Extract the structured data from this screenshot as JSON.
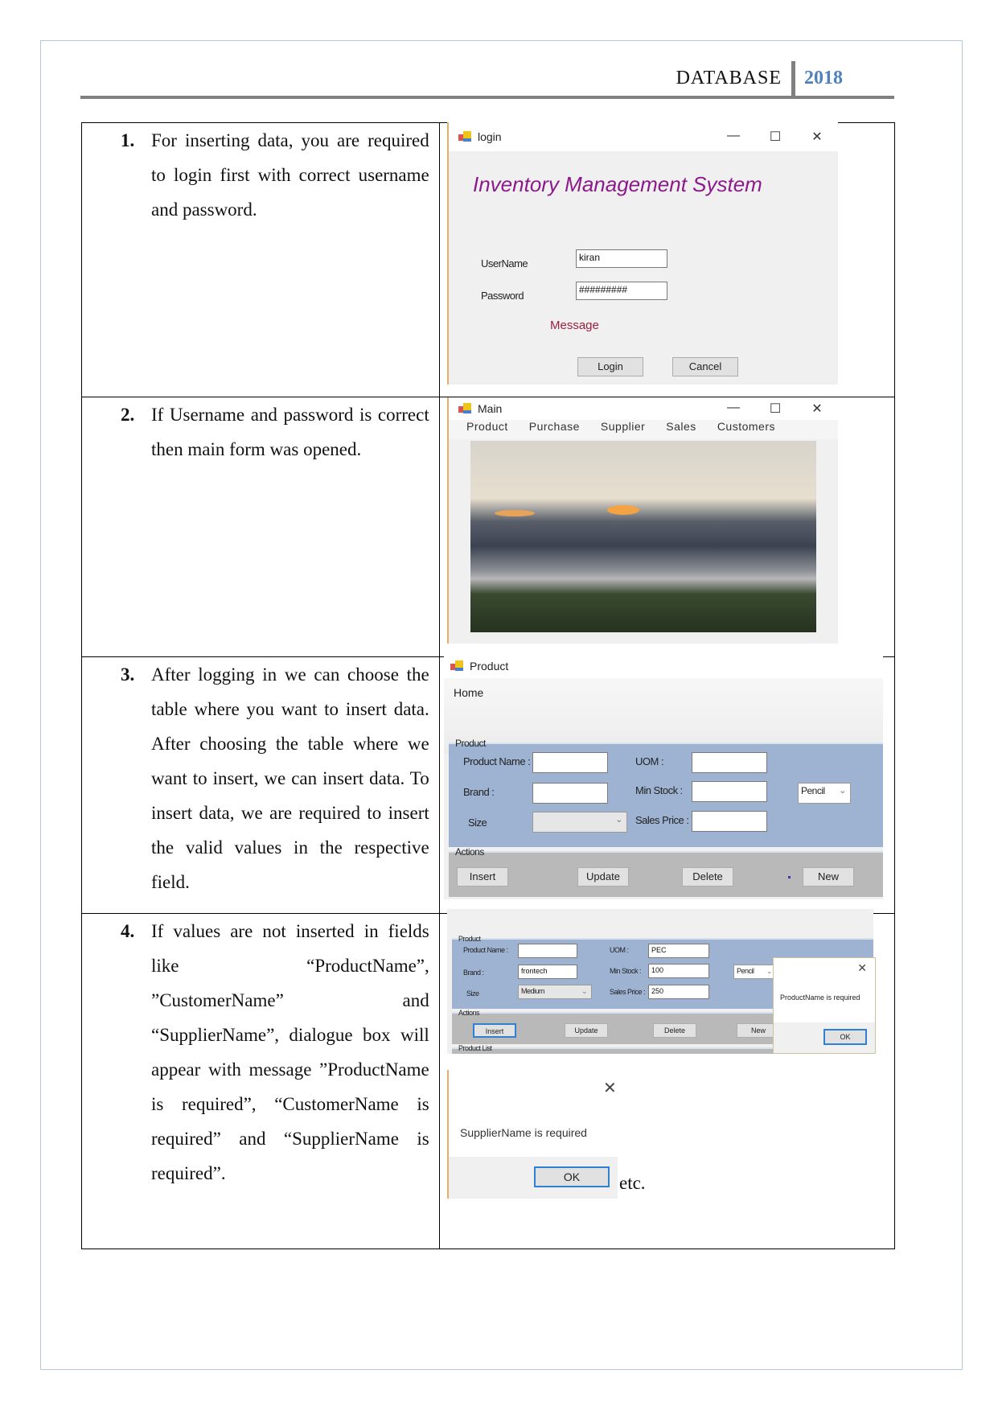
{
  "header": {
    "title": "DATABASE",
    "year": "2018"
  },
  "steps": [
    {
      "num": "1.",
      "text": "For inserting data, you are required to login first with correct username and password."
    },
    {
      "num": "2.",
      "text": "If Username and password is correct then main form was opened."
    },
    {
      "num": "3.",
      "text": "After logging in we can choose the table where you want to insert data. After choosing the table where we want to insert, we can insert data. To insert data, we are required to insert the valid values in the respective field."
    },
    {
      "num": "4.",
      "text": "If values are not inserted in fields like “ProductName”, ”CustomerName” and “SupplierName”, dialogue box will appear with message ”ProductName is required”, “CustomerName is required” and “SupplierName is required”."
    }
  ],
  "window_controls": {
    "minimize": "—",
    "maximize": "☐",
    "close": "✕"
  },
  "login": {
    "title": "login",
    "heading": "Inventory Management System",
    "username_label": "UserName",
    "username_value": "kiran",
    "password_label": "Password",
    "password_value": "#########",
    "message": "Message",
    "login_button": "Login",
    "cancel_button": "Cancel",
    "heading_color": "#8b1a8b"
  },
  "main": {
    "title": "Main",
    "menu": [
      "Product",
      "Purchase",
      "Supplier",
      "Sales",
      "Customers"
    ],
    "image_description": "sunset-clouds-landscape"
  },
  "product_form": {
    "title": "Product",
    "home_tab": "Home",
    "group_product": "Product",
    "group_actions": "Actions",
    "group_list": "Product List",
    "labels": {
      "product_name": "Product Name :",
      "brand": "Brand :",
      "size": "Size",
      "uom": "UOM :",
      "min_stock": "Min Stock :",
      "sales_price": "Sales Price :"
    },
    "empty_values": {
      "product_name": "",
      "brand": "",
      "size": "",
      "uom": "",
      "min_stock": "",
      "sales_price": "",
      "category": "Pencil"
    },
    "filled_values": {
      "product_name": "",
      "brand": "frontech",
      "size": "Medium",
      "uom": "PEC",
      "min_stock": "100",
      "sales_price": "250",
      "category": "Pencil"
    },
    "buttons": {
      "insert": "Insert",
      "update": "Update",
      "delete": "Delete",
      "new": "New"
    },
    "panel_color": "#9db3d1"
  },
  "dialogs": {
    "product": {
      "message": "ProductName is required",
      "ok": "OK"
    },
    "supplier": {
      "message": "SupplierName is required",
      "ok": "OK"
    }
  },
  "etc": "etc."
}
